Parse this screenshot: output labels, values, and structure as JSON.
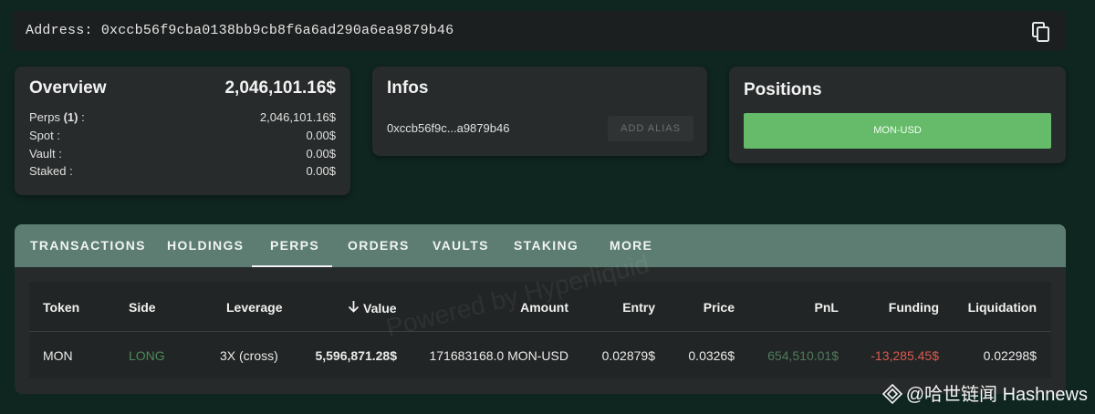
{
  "address": {
    "text": "Address: 0xccb56f9cba0138bb9cb8f6a6ad290a6ea9879b46",
    "copy_icon": "copy-icon"
  },
  "overview": {
    "title": "Overview",
    "total": "2,046,101.16$",
    "rows": [
      {
        "label": "Perps ",
        "count": "(1)",
        "suffix": " :",
        "value": "2,046,101.16$"
      },
      {
        "label": "Spot :",
        "value": "0.00$"
      },
      {
        "label": "Vault :",
        "value": "0.00$"
      },
      {
        "label": "Staked :",
        "value": "0.00$"
      }
    ]
  },
  "infos": {
    "title": "Infos",
    "short_address": "0xccb56f9c...a9879b46",
    "add_alias_label": "ADD ALIAS"
  },
  "positions": {
    "title": "Positions",
    "items": [
      "MON-USD"
    ]
  },
  "tabs": [
    "TRANSACTIONS",
    "HOLDINGS",
    "PERPS",
    "ORDERS",
    "VAULTS",
    "STAKING",
    "MORE"
  ],
  "active_tab": "PERPS",
  "table": {
    "headers": [
      "Token",
      "Side",
      "Leverage",
      "Value",
      "Amount",
      "Entry",
      "Price",
      "PnL",
      "Funding",
      "Liquidation"
    ],
    "sort_icon": "arrow-down-icon",
    "rows": [
      {
        "token": "MON",
        "side": "LONG",
        "leverage": "3X (cross)",
        "value": "5,596,871.28$",
        "amount": "171683168.0 MON-USD",
        "entry": "0.02879$",
        "price": "0.0326$",
        "pnl": "654,510.01$",
        "funding": "-13,285.45$",
        "liquidation": "0.02298$"
      }
    ]
  },
  "watermark": "Powered by Hyperliquid",
  "brand": "@哈世链闻 Hashnews",
  "colors": {
    "background": "#0f2520",
    "card": "#282b2b",
    "tabbar": "#5d7d72",
    "position_button": "#66bb6a",
    "long": "#4c8a5a",
    "pnl_positive": "#4f7a5c",
    "funding_negative": "#d85a4e"
  }
}
